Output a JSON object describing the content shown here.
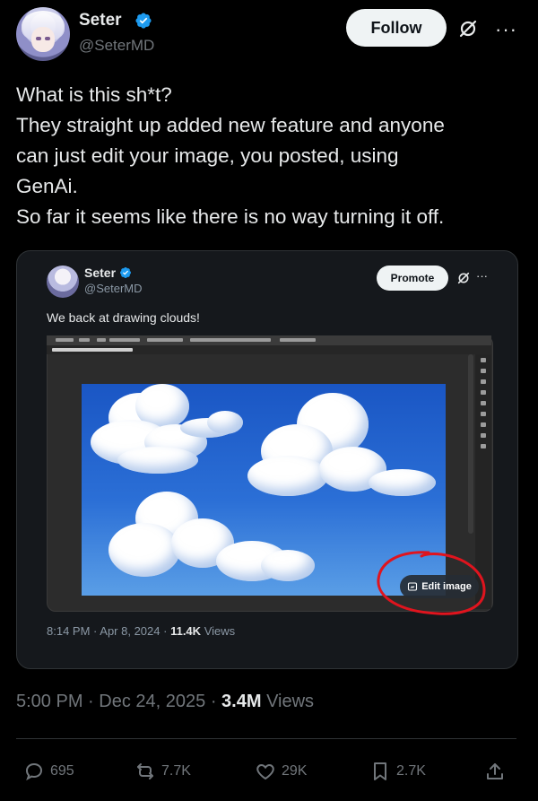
{
  "author": {
    "name": "Seter",
    "handle": "@SeterMD",
    "follow_label": "Follow"
  },
  "tweet": {
    "lines": [
      "What is this sh*t?",
      "They straight up added new feature and anyone",
      "can just edit your image, you posted, using",
      "GenAi.",
      "So far it seems like there is no way turning it off."
    ],
    "time": "5:00 PM",
    "date": "Dec 24, 2025",
    "views_count": "3.4M",
    "views_label": "Views"
  },
  "quote": {
    "name": "Seter",
    "handle": "@SeterMD",
    "promote_label": "Promote",
    "text": "We back at drawing clouds!",
    "edit_image_label": "Edit image",
    "time": "8:14 PM",
    "date": "Apr 8, 2024",
    "views_count": "11.4K",
    "views_label": "Views"
  },
  "actions": {
    "replies": "695",
    "reposts": "7.7K",
    "likes": "29K",
    "bookmarks": "2.7K"
  },
  "colors": {
    "background": "#000000",
    "text": "#e7e9ea",
    "muted": "#71767b",
    "verified": "#1d9bf0",
    "annotation_red": "#e0141e"
  }
}
